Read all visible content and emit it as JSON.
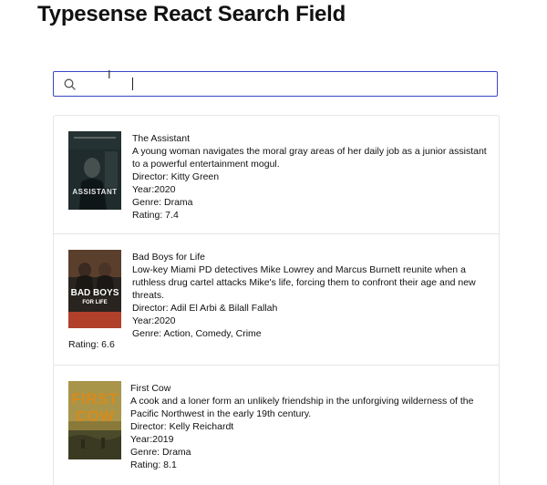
{
  "header": {
    "title": "Typesense React Search Field"
  },
  "search": {
    "placeholder": "",
    "value": ""
  },
  "hits": [
    {
      "title": "The Assistant",
      "description": "A young woman navigates the moral gray areas of her daily job as a junior assistant to a powerful entertainment mogul.",
      "director": "Director: Kitty Green",
      "year": "Year:2020",
      "genre": "Genre: Drama",
      "rating": "Rating: 7.4",
      "poster_text": "ASSISTANT"
    },
    {
      "title": "Bad Boys for Life",
      "description": "Low-key Miami PD detectives Mike Lowrey and Marcus Burnett reunite when a ruthless drug cartel attacks Mike's life, forcing them to confront their age and new threats.",
      "director": "Director: Adil El Arbi & Bilall Fallah",
      "year": "Year:2020",
      "genre": "Genre: Action, Comedy, Crime",
      "rating": "Rating: 6.6",
      "poster_text_1": "BAD BOYS",
      "poster_text_2": "FOR LIFE"
    },
    {
      "title": "First Cow",
      "description": "A cook and a loner form an unlikely friendship in the unforgiving wilderness of the Pacific Northwest in the early 19th century.",
      "director": "Director: Kelly Reichardt",
      "year": "Year:2019",
      "genre": "Genre: Drama",
      "rating": "Rating: 8.1",
      "poster_text_1": "FIRST",
      "poster_text_2": "COW"
    }
  ],
  "colors": {
    "search_border": "#3a45c8",
    "card_border": "#e6e6e6"
  }
}
